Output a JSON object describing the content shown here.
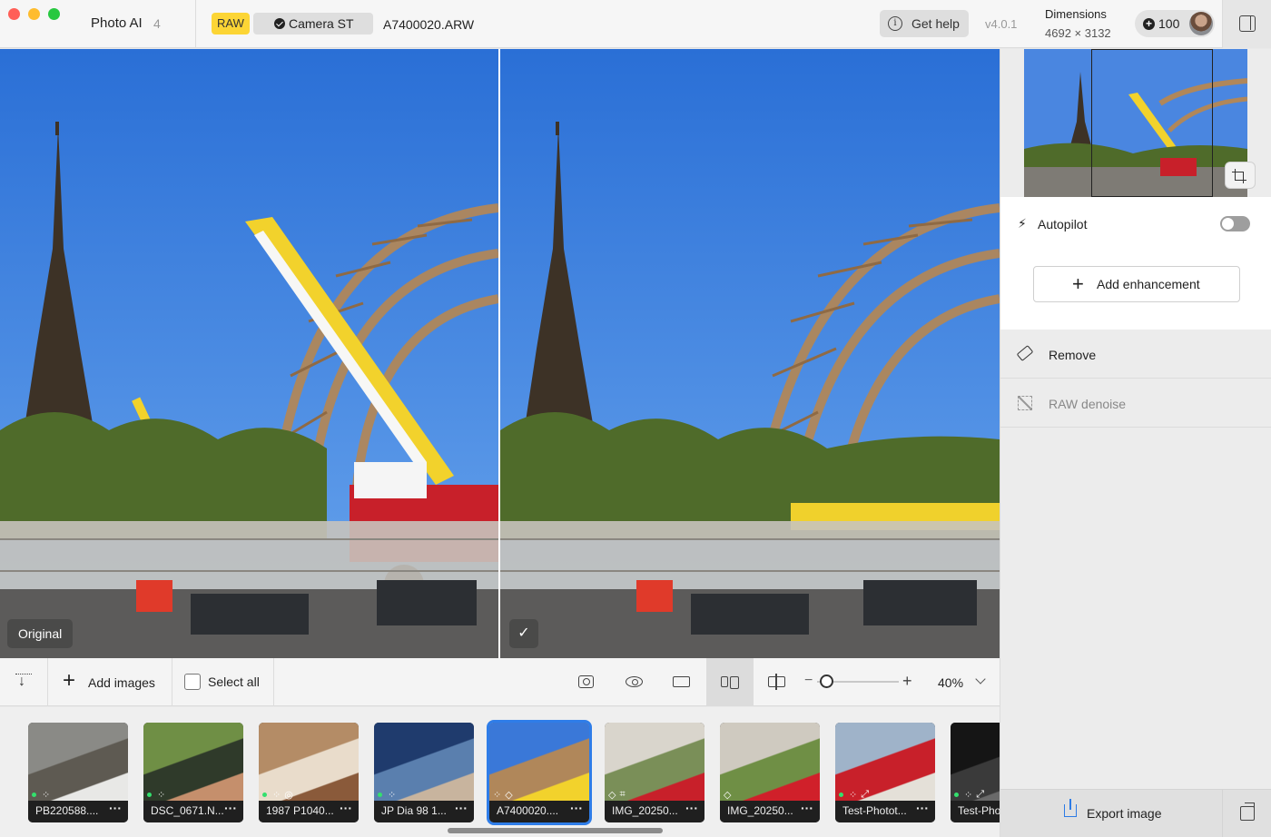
{
  "window": {
    "app_name": "Photo AI",
    "image_count": "4"
  },
  "header": {
    "raw_badge": "RAW",
    "model_label": "Camera ST",
    "filename": "A7400020.ARW",
    "help_label": "Get help",
    "version": "v4.0.1",
    "dimensions_label": "Dimensions",
    "dimensions_value": "4692 × 3132",
    "credits": "100"
  },
  "canvas": {
    "original_label": "Original",
    "processed_badge": "✓"
  },
  "panel": {
    "autopilot_label": "Autopilot",
    "autopilot_on": false,
    "add_enhancement_label": "Add enhancement",
    "tools": [
      {
        "label": "Remove",
        "icon": "eraser-icon",
        "enabled": true
      },
      {
        "label": "RAW denoise",
        "icon": "raw-denoise-icon",
        "enabled": false
      }
    ],
    "export_label": "Export image"
  },
  "toolbar": {
    "add_images_label": "Add images",
    "select_all_label": "Select all",
    "zoom_value": "40%",
    "view_modes": [
      "snapshot-icon",
      "eye-icon",
      "single-view-icon",
      "side-by-side-icon",
      "split-view-icon"
    ],
    "active_view": "side-by-side-icon"
  },
  "filmstrip": {
    "items": [
      {
        "name": "PB220588....",
        "badges": [
          "dot",
          "sparkle"
        ],
        "selected": false
      },
      {
        "name": "DSC_0671.N...",
        "badges": [
          "dot",
          "sparkle"
        ],
        "selected": false
      },
      {
        "name": "1987 P1040...",
        "badges": [
          "dot",
          "sparkle",
          "face"
        ],
        "selected": false
      },
      {
        "name": "JP Dia 98 1...",
        "badges": [
          "dot",
          "sparkle"
        ],
        "selected": false
      },
      {
        "name": "A7400020....",
        "badges": [
          "sparkle",
          "eraser"
        ],
        "selected": true
      },
      {
        "name": "IMG_20250...",
        "badges": [
          "eraser",
          "crop"
        ],
        "selected": false
      },
      {
        "name": "IMG_20250...",
        "badges": [
          "eraser"
        ],
        "selected": false
      },
      {
        "name": "Test-Photot...",
        "badges": [
          "dot",
          "sparkle",
          "upscale"
        ],
        "selected": false
      },
      {
        "name": "Test-Pho",
        "badges": [
          "dot",
          "sparkle",
          "upscale"
        ],
        "selected": false
      }
    ]
  },
  "colors": {
    "accent": "#2f7de8",
    "raw_badge": "#fcd535",
    "active_dot": "#33e06d"
  }
}
